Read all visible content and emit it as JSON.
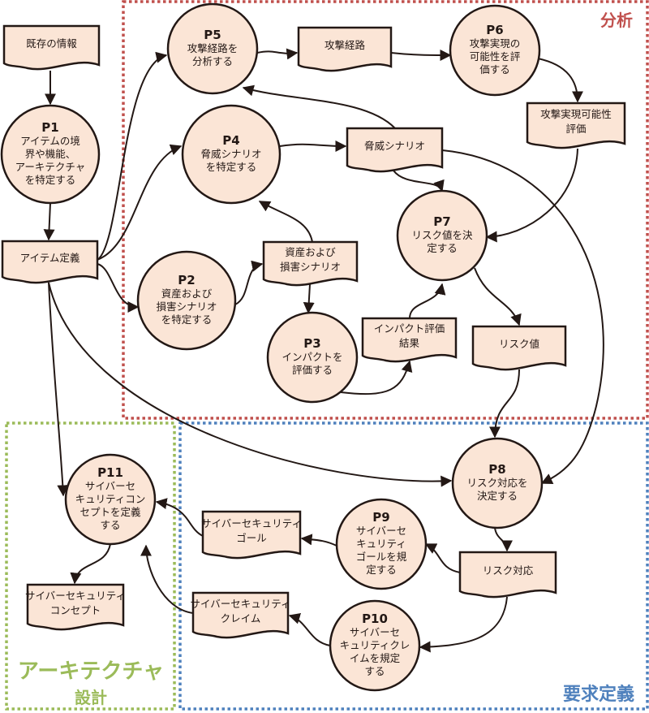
{
  "colors": {
    "node_fill": "#fbe5d6",
    "stroke": "#231815",
    "analysis": "#c0504d",
    "architecture": "#9bbb59",
    "requirements": "#4f81bd"
  },
  "regions": [
    {
      "id": "analysis",
      "label": [
        "分析"
      ]
    },
    {
      "id": "architecture",
      "label": [
        "アーキテクチャ",
        "設計"
      ]
    },
    {
      "id": "requirements",
      "label": [
        "要求定義"
      ]
    }
  ],
  "processes": [
    {
      "id": "P1",
      "lines": [
        "アイテムの境",
        "界や機能、",
        "アーキテクチャ",
        "を特定する"
      ]
    },
    {
      "id": "P2",
      "lines": [
        "資産および",
        "損害シナリオ",
        "を特定する"
      ]
    },
    {
      "id": "P3",
      "lines": [
        "インパクトを",
        "評価する"
      ]
    },
    {
      "id": "P4",
      "lines": [
        "脅威シナリオ",
        "を特定する"
      ]
    },
    {
      "id": "P5",
      "lines": [
        "攻撃経路を",
        "分析する"
      ]
    },
    {
      "id": "P6",
      "lines": [
        "攻撃実現の",
        "可能性を評",
        "価する"
      ]
    },
    {
      "id": "P7",
      "lines": [
        "リスク値を決",
        "定する"
      ]
    },
    {
      "id": "P8",
      "lines": [
        "リスク対応を",
        "決定する"
      ]
    },
    {
      "id": "P9",
      "lines": [
        "サイバーセ",
        "キュリティ",
        "ゴールを規",
        "定する"
      ]
    },
    {
      "id": "P10",
      "lines": [
        "サイバーセ",
        "キュリティクレ",
        "イムを規定",
        "する"
      ]
    },
    {
      "id": "P11",
      "lines": [
        "サイバーセ",
        "キュリティコン",
        "セプトを定義",
        "する"
      ]
    }
  ],
  "documents": [
    {
      "id": "existing",
      "lines": [
        "既存の情報"
      ]
    },
    {
      "id": "item",
      "lines": [
        "アイテム定義"
      ]
    },
    {
      "id": "attack_path",
      "lines": [
        "攻撃経路"
      ]
    },
    {
      "id": "feasibility",
      "lines": [
        "攻撃実現可能性",
        "評価"
      ]
    },
    {
      "id": "threat",
      "lines": [
        "脅威シナリオ"
      ]
    },
    {
      "id": "asset",
      "lines": [
        "資産および",
        "損害シナリオ"
      ]
    },
    {
      "id": "impact",
      "lines": [
        "インパクト評価",
        "結果"
      ]
    },
    {
      "id": "risk_value",
      "lines": [
        "リスク値"
      ]
    },
    {
      "id": "risk_treatment",
      "lines": [
        "リスク対応"
      ]
    },
    {
      "id": "goal",
      "lines": [
        "サイバーセキュリティ",
        "ゴール"
      ]
    },
    {
      "id": "claim",
      "lines": [
        "サイバーセキュリティ",
        "クレイム"
      ]
    },
    {
      "id": "concept",
      "lines": [
        "サイバーセキュリティ",
        "コンセプト"
      ]
    }
  ],
  "edges": [
    [
      "existing",
      "P1"
    ],
    [
      "P1",
      "item"
    ],
    [
      "item",
      "P5"
    ],
    [
      "item",
      "P4"
    ],
    [
      "item",
      "P2"
    ],
    [
      "item",
      "P11"
    ],
    [
      "item",
      "P8"
    ],
    [
      "P5",
      "attack_path"
    ],
    [
      "attack_path",
      "P6"
    ],
    [
      "P6",
      "feasibility"
    ],
    [
      "feasibility",
      "P7"
    ],
    [
      "P4",
      "threat"
    ],
    [
      "threat",
      "P5"
    ],
    [
      "threat",
      "P7"
    ],
    [
      "threat",
      "P8"
    ],
    [
      "P2",
      "asset"
    ],
    [
      "asset",
      "P4"
    ],
    [
      "asset",
      "P3"
    ],
    [
      "P3",
      "impact"
    ],
    [
      "impact",
      "P7"
    ],
    [
      "P7",
      "risk_value"
    ],
    [
      "risk_value",
      "P8"
    ],
    [
      "P8",
      "risk_treatment"
    ],
    [
      "risk_treatment",
      "P9"
    ],
    [
      "P9",
      "goal"
    ],
    [
      "goal",
      "P11"
    ],
    [
      "risk_treatment",
      "P10"
    ],
    [
      "P10",
      "claim"
    ],
    [
      "claim",
      "P11"
    ],
    [
      "P11",
      "concept"
    ]
  ]
}
